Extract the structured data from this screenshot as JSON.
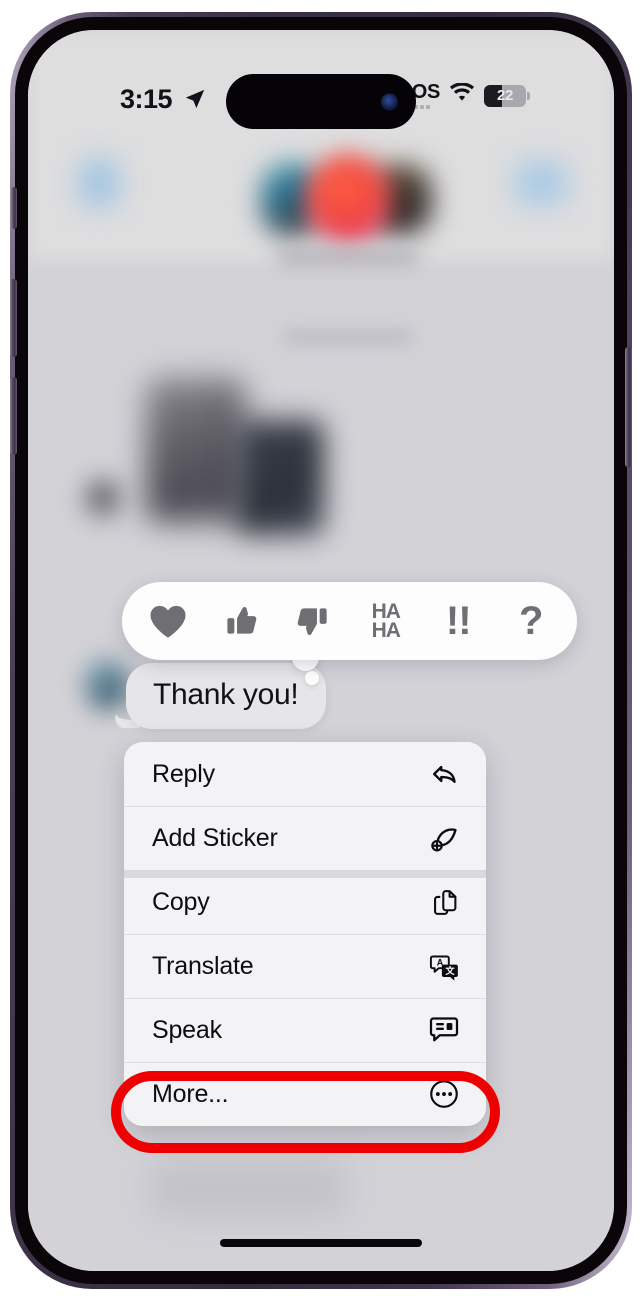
{
  "device": {
    "name": "iphone-14-pro",
    "frame_color": "#3a3145",
    "buttons": [
      "action-button",
      "volume-up-button",
      "volume-down-button",
      "power-button"
    ]
  },
  "status_bar": {
    "time": "3:15",
    "location_icon": "location-arrow-icon",
    "sos_label": "SOS",
    "wifi_icon": "wifi-icon",
    "battery_percent": "22"
  },
  "reaction_bar": {
    "reactions": [
      {
        "name": "heart",
        "icon": "heart-icon",
        "label": ""
      },
      {
        "name": "thumbs-up",
        "icon": "thumbs-up-icon",
        "label": ""
      },
      {
        "name": "thumbs-down",
        "icon": "thumbs-down-icon",
        "label": ""
      },
      {
        "name": "haha",
        "icon": "haha-text-icon",
        "line1": "HA",
        "line2": "HA"
      },
      {
        "name": "exclamation",
        "icon": "double-exclamation-icon",
        "label": "!!"
      },
      {
        "name": "question",
        "icon": "question-mark-icon",
        "label": "?"
      }
    ]
  },
  "message": {
    "text": "Thank you!",
    "sender": "incoming",
    "bubble_color": "#e6e6e9"
  },
  "context_menu": {
    "items": [
      {
        "label": "Reply",
        "icon": "reply-arrow-icon",
        "highlighted": false
      },
      {
        "label": "Add Sticker",
        "icon": "add-sticker-icon",
        "highlighted": false
      },
      {
        "label": "Copy",
        "icon": "copy-documents-icon",
        "highlighted": false
      },
      {
        "label": "Translate",
        "icon": "translate-icon",
        "highlighted": false
      },
      {
        "label": "Speak",
        "icon": "speak-bubble-icon",
        "highlighted": false
      },
      {
        "label": "More...",
        "icon": "ellipsis-circle-icon",
        "highlighted": true
      }
    ]
  },
  "annotation": {
    "highlight_color": "#ef0000",
    "highlight_target": "More..."
  }
}
